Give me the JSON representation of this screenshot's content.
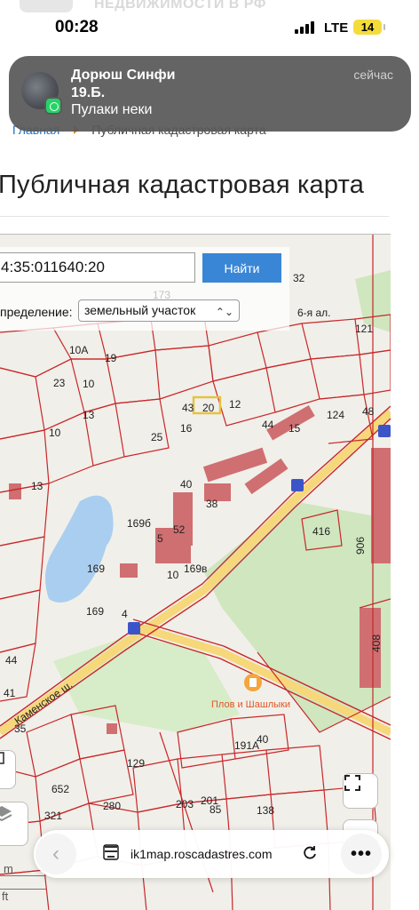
{
  "status_bar": {
    "banner": "НЕДВИЖИМОСТИ В РФ",
    "time": "00:28",
    "network": "LTE",
    "battery": "14"
  },
  "notification": {
    "sender": "Дорюш Синфи 19.Б.",
    "message": "Пулаки неки",
    "time": "сейчас"
  },
  "breadcrumb": {
    "home": "Главная",
    "current": "Публичная кадастровая карта"
  },
  "page": {
    "title": "Публичная кадастровая карта"
  },
  "map": {
    "search_value": "4:35:011640:20",
    "search_button": "Найти",
    "definition_label": "пределение:",
    "definition_value": "земельный участок",
    "scale_top": "m",
    "scale_bottom": "ft",
    "labels": [
      {
        "t": "173"
      },
      {
        "t": "32"
      },
      {
        "t": "6-я ал."
      },
      {
        "t": "121"
      },
      {
        "t": "10А"
      },
      {
        "t": "19"
      },
      {
        "t": "23"
      },
      {
        "t": "10"
      },
      {
        "t": "20"
      },
      {
        "t": "12"
      },
      {
        "t": "43"
      },
      {
        "t": "44"
      },
      {
        "t": "13"
      },
      {
        "t": "15"
      },
      {
        "t": "16"
      },
      {
        "t": "48"
      },
      {
        "t": "124"
      },
      {
        "t": "25"
      },
      {
        "t": "10"
      },
      {
        "t": "13"
      },
      {
        "t": "40"
      },
      {
        "t": "38"
      },
      {
        "t": "169"
      },
      {
        "t": "169б"
      },
      {
        "t": "5"
      },
      {
        "t": "52"
      },
      {
        "t": "169в"
      },
      {
        "t": "10"
      },
      {
        "t": "416"
      },
      {
        "t": "906"
      },
      {
        "t": "408"
      },
      {
        "t": "169"
      },
      {
        "t": "4"
      },
      {
        "t": "44"
      },
      {
        "t": "41"
      },
      {
        "t": "35"
      },
      {
        "t": "Каменское ш."
      },
      {
        "t": "Плов и Шашлыки"
      },
      {
        "t": "191А"
      },
      {
        "t": "40"
      },
      {
        "t": "129"
      },
      {
        "t": "652"
      },
      {
        "t": "280"
      },
      {
        "t": "321"
      },
      {
        "t": "201"
      },
      {
        "t": "85"
      },
      {
        "t": "203"
      },
      {
        "t": "138"
      }
    ]
  }
}
